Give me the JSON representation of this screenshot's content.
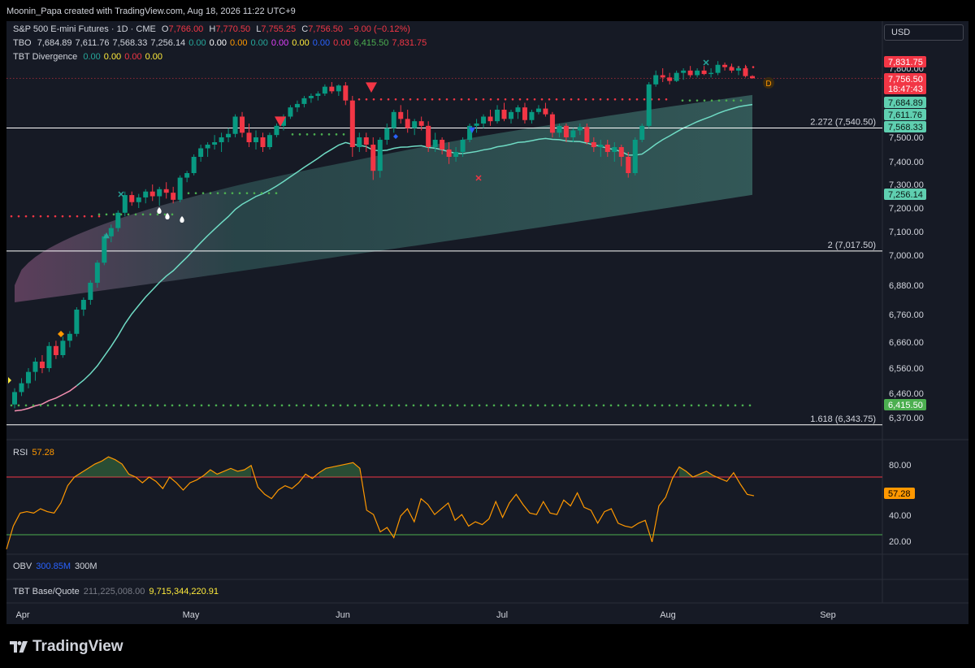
{
  "header": {
    "credit": "Moonin_Papa created with TradingView.com, Aug 18, 2026 11:22 UTC+9"
  },
  "legend": {
    "symbol": "S&P 500 E-mini Futures · 1D · CME",
    "o_label": "O",
    "o_value": "7,766.00",
    "h_label": "H",
    "h_value": "7,770.50",
    "l_label": "L",
    "l_value": "7,755.25",
    "c_label": "C",
    "c_value": "7,756.50",
    "change": "−9.00 (−0.12%)",
    "tbo_label": "TBO",
    "tbo_values": [
      {
        "v": "7,684.89",
        "c": "#d1d4dc"
      },
      {
        "v": "7,611.76",
        "c": "#d1d4dc"
      },
      {
        "v": "7,568.33",
        "c": "#d1d4dc"
      },
      {
        "v": "7,256.14",
        "c": "#d1d4dc"
      },
      {
        "v": "0.00",
        "c": "#26a69a"
      },
      {
        "v": "0.00",
        "c": "#ffffff"
      },
      {
        "v": "0.00",
        "c": "#ff9800"
      },
      {
        "v": "0.00",
        "c": "#26a69a"
      },
      {
        "v": "0.00",
        "c": "#e040fb"
      },
      {
        "v": "0.00",
        "c": "#ffeb3b"
      },
      {
        "v": "0.00",
        "c": "#2962ff"
      },
      {
        "v": "0.00",
        "c": "#f23645"
      },
      {
        "v": "6,415.50",
        "c": "#4caf50"
      },
      {
        "v": "7,831.75",
        "c": "#f23645"
      }
    ],
    "div_label": "TBT Divergence",
    "div_values": [
      {
        "v": "0.00",
        "c": "#26a69a"
      },
      {
        "v": "0.00",
        "c": "#ffeb3b"
      },
      {
        "v": "0.00",
        "c": "#f23645"
      },
      {
        "v": "0.00",
        "c": "#ffeb3b"
      }
    ]
  },
  "currency_button": "USD",
  "panes": {
    "rsi_label": "RSI",
    "rsi_value": "57.28",
    "obv_label": "OBV",
    "obv_value": "300.85M",
    "obv_value2": "300M",
    "bq_label": "TBT Base/Quote",
    "bq_value1": "211,225,008.00",
    "bq_value2": "9,715,344,220.91"
  },
  "brand": "TradingView",
  "colors": {
    "bg": "#161a25",
    "up": "#089981",
    "down": "#f23645",
    "rsi": "#ff9800",
    "line_fast": "#6fdbc4",
    "green_dots": "#4caf50",
    "red_dots": "#f23645"
  },
  "chart_data": {
    "type": "candlestick",
    "x_axis": [
      "Apr",
      "May",
      "Jun",
      "Jul",
      "Aug",
      "Sep"
    ],
    "price_ticks": [
      "7,800.00",
      "7,500.00",
      "7,400.00",
      "7,300.00",
      "7,200.00",
      "7,100.00",
      "7,000.00",
      "6,880.00",
      "6,760.00",
      "6,660.00",
      "6,560.00",
      "6,460.00",
      "6,370.00"
    ],
    "price_labels": [
      {
        "text": "7,831.75",
        "price": 7831.75,
        "bg": "#f23645",
        "fg": "#ffffff"
      },
      {
        "text": "7,756.50",
        "sub": "18:47:43",
        "price": 7756.5,
        "bg": "#f23645",
        "fg": "#ffffff"
      },
      {
        "text": "7,684.89",
        "price": 7684.89,
        "bg": "#5fcfb0",
        "fg": "#0b1a16"
      },
      {
        "text": "7,611.76",
        "price": 7611.76,
        "bg": "#5fcfb0",
        "fg": "#0b1a16"
      },
      {
        "text": "7,568.33",
        "price": 7568.33,
        "bg": "#5fcfb0",
        "fg": "#0b1a16"
      },
      {
        "text": "7,256.14",
        "price": 7256.14,
        "bg": "#5fcfb0",
        "fg": "#0b1a16"
      },
      {
        "text": "6,415.50",
        "price": 6415.5,
        "bg": "#4caf50",
        "fg": "#ffffff"
      }
    ],
    "fib_levels": [
      {
        "label": "2.272 (7,540.50)",
        "price": 7540.5
      },
      {
        "label": "2 (7,017.50)",
        "price": 7017.5
      },
      {
        "label": "1.618 (6,343.75)",
        "price": 6343.75
      }
    ],
    "green_dotted_level": 6415.5,
    "red_dotted_level": 7831.75,
    "rsi": {
      "ticks": [
        "80.00",
        "40.00",
        "20.00"
      ],
      "overbought": 70,
      "oversold": 30,
      "last": 57.28,
      "values": [
        20,
        36,
        45,
        46,
        45,
        48,
        46,
        45,
        52,
        64,
        70,
        73,
        76,
        79,
        81,
        84,
        82,
        79,
        72,
        70,
        66,
        70,
        67,
        62,
        70,
        66,
        61,
        66,
        68,
        71,
        75,
        72,
        74,
        76,
        74,
        75,
        78,
        63,
        58,
        55,
        61,
        64,
        62,
        66,
        72,
        69,
        73,
        76,
        77,
        78,
        79,
        80,
        76,
        47,
        44,
        32,
        35,
        28,
        43,
        48,
        39,
        55,
        51,
        44,
        48,
        52,
        40,
        44,
        36,
        39,
        37,
        41,
        53,
        42,
        52,
        58,
        51,
        45,
        44,
        53,
        45,
        44,
        54,
        50,
        59,
        49,
        47,
        38,
        46,
        48,
        38,
        36,
        35,
        38,
        40,
        25,
        50,
        56,
        69,
        77,
        74,
        70,
        72,
        74,
        71,
        69,
        67,
        73,
        65,
        58,
        57
      ],
      "label_lines": {
        "overbought_color": "#f23645",
        "oversold_color": "#4caf50"
      }
    },
    "candles": [
      [
        6419,
        6480,
        6405,
        6465
      ],
      [
        6465,
        6520,
        6450,
        6500
      ],
      [
        6500,
        6560,
        6480,
        6545
      ],
      [
        6545,
        6600,
        6510,
        6585
      ],
      [
        6585,
        6610,
        6540,
        6560
      ],
      [
        6560,
        6660,
        6545,
        6645
      ],
      [
        6645,
        6665,
        6595,
        6610
      ],
      [
        6610,
        6680,
        6600,
        6665
      ],
      [
        6665,
        6700,
        6640,
        6690
      ],
      [
        6690,
        6790,
        6680,
        6780
      ],
      [
        6780,
        6830,
        6755,
        6820
      ],
      [
        6820,
        6900,
        6800,
        6890
      ],
      [
        6890,
        6980,
        6870,
        6970
      ],
      [
        6970,
        7090,
        6960,
        7080
      ],
      [
        7080,
        7130,
        7055,
        7115
      ],
      [
        7115,
        7190,
        7100,
        7180
      ],
      [
        7180,
        7270,
        7165,
        7255
      ],
      [
        7255,
        7270,
        7210,
        7225
      ],
      [
        7225,
        7260,
        7200,
        7245
      ],
      [
        7245,
        7280,
        7220,
        7270
      ],
      [
        7270,
        7300,
        7230,
        7250
      ],
      [
        7250,
        7290,
        7210,
        7280
      ],
      [
        7280,
        7310,
        7240,
        7265
      ],
      [
        7265,
        7290,
        7220,
        7235
      ],
      [
        7235,
        7340,
        7225,
        7330
      ],
      [
        7330,
        7360,
        7310,
        7350
      ],
      [
        7350,
        7430,
        7340,
        7420
      ],
      [
        7420,
        7470,
        7400,
        7455
      ],
      [
        7455,
        7480,
        7420,
        7470
      ],
      [
        7470,
        7510,
        7450,
        7480
      ],
      [
        7480,
        7520,
        7440,
        7500
      ],
      [
        7500,
        7540,
        7480,
        7515
      ],
      [
        7515,
        7600,
        7500,
        7590
      ],
      [
        7590,
        7610,
        7500,
        7520
      ],
      [
        7520,
        7560,
        7460,
        7480
      ],
      [
        7480,
        7530,
        7450,
        7500
      ],
      [
        7500,
        7520,
        7440,
        7460
      ],
      [
        7460,
        7520,
        7450,
        7510
      ],
      [
        7510,
        7560,
        7500,
        7550
      ],
      [
        7550,
        7600,
        7530,
        7590
      ],
      [
        7590,
        7640,
        7580,
        7630
      ],
      [
        7630,
        7660,
        7610,
        7645
      ],
      [
        7645,
        7680,
        7630,
        7670
      ],
      [
        7670,
        7690,
        7650,
        7680
      ],
      [
        7680,
        7700,
        7660,
        7690
      ],
      [
        7690,
        7730,
        7680,
        7720
      ],
      [
        7720,
        7740,
        7690,
        7700
      ],
      [
        7700,
        7730,
        7680,
        7725
      ],
      [
        7725,
        7740,
        7640,
        7660
      ],
      [
        7660,
        7680,
        7420,
        7460
      ],
      [
        7460,
        7520,
        7440,
        7500
      ],
      [
        7500,
        7520,
        7440,
        7470
      ],
      [
        7470,
        7500,
        7320,
        7360
      ],
      [
        7360,
        7500,
        7330,
        7490
      ],
      [
        7490,
        7560,
        7470,
        7540
      ],
      [
        7540,
        7620,
        7520,
        7610
      ],
      [
        7610,
        7640,
        7560,
        7580
      ],
      [
        7580,
        7620,
        7520,
        7540
      ],
      [
        7540,
        7580,
        7510,
        7570
      ],
      [
        7570,
        7590,
        7530,
        7550
      ],
      [
        7550,
        7570,
        7440,
        7460
      ],
      [
        7460,
        7520,
        7440,
        7490
      ],
      [
        7490,
        7500,
        7430,
        7450
      ],
      [
        7450,
        7480,
        7390,
        7420
      ],
      [
        7420,
        7460,
        7400,
        7440
      ],
      [
        7440,
        7500,
        7420,
        7490
      ],
      [
        7490,
        7560,
        7480,
        7550
      ],
      [
        7550,
        7580,
        7520,
        7560
      ],
      [
        7560,
        7600,
        7540,
        7590
      ],
      [
        7590,
        7620,
        7550,
        7570
      ],
      [
        7570,
        7640,
        7560,
        7620
      ],
      [
        7620,
        7650,
        7570,
        7580
      ],
      [
        7580,
        7620,
        7560,
        7610
      ],
      [
        7610,
        7640,
        7580,
        7630
      ],
      [
        7630,
        7650,
        7560,
        7575
      ],
      [
        7575,
        7620,
        7560,
        7610
      ],
      [
        7610,
        7640,
        7600,
        7625
      ],
      [
        7625,
        7650,
        7590,
        7600
      ],
      [
        7600,
        7610,
        7500,
        7520
      ],
      [
        7520,
        7560,
        7500,
        7550
      ],
      [
        7550,
        7560,
        7480,
        7500
      ],
      [
        7500,
        7540,
        7480,
        7530
      ],
      [
        7530,
        7560,
        7510,
        7545
      ],
      [
        7545,
        7560,
        7470,
        7480
      ],
      [
        7480,
        7500,
        7440,
        7460
      ],
      [
        7460,
        7490,
        7420,
        7470
      ],
      [
        7470,
        7490,
        7420,
        7440
      ],
      [
        7440,
        7480,
        7400,
        7460
      ],
      [
        7460,
        7470,
        7380,
        7420
      ],
      [
        7420,
        7440,
        7330,
        7350
      ],
      [
        7350,
        7500,
        7340,
        7490
      ],
      [
        7490,
        7560,
        7480,
        7550
      ],
      [
        7550,
        7740,
        7540,
        7730
      ],
      [
        7730,
        7790,
        7720,
        7770
      ],
      [
        7770,
        7800,
        7740,
        7760
      ],
      [
        7760,
        7780,
        7730,
        7745
      ],
      [
        7745,
        7790,
        7740,
        7780
      ],
      [
        7780,
        7800,
        7750,
        7790
      ],
      [
        7790,
        7810,
        7760,
        7770
      ],
      [
        7770,
        7800,
        7760,
        7790
      ],
      [
        7790,
        7810,
        7770,
        7775
      ],
      [
        7775,
        7800,
        7760,
        7780
      ],
      [
        7780,
        7831,
        7770,
        7815
      ],
      [
        7815,
        7825,
        7790,
        7805
      ],
      [
        7805,
        7820,
        7780,
        7790
      ],
      [
        7790,
        7810,
        7770,
        7800
      ],
      [
        7800,
        7815,
        7760,
        7766
      ],
      [
        7766,
        7770,
        7755,
        7756.5
      ]
    ]
  }
}
